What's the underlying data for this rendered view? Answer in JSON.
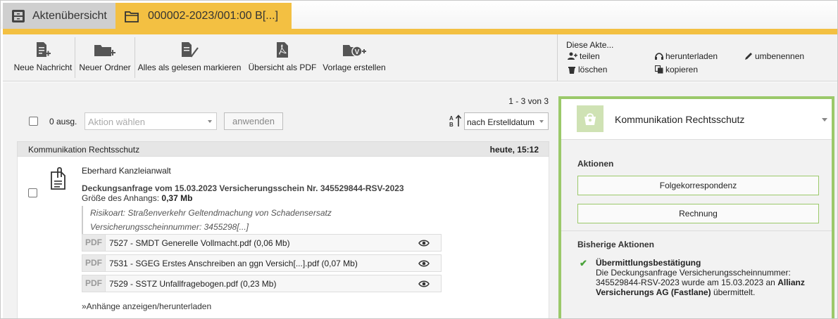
{
  "tabs": {
    "home_label": "Aktenübersicht",
    "active_label": "000002-2023/001:00 B[...]"
  },
  "toolbar": {
    "new_message": "Neue Nachricht",
    "new_folder": "Neuer Ordner",
    "mark_all_read": "Alles als gelesen markieren",
    "overview_pdf": "Übersicht als PDF",
    "create_template": "Vorlage erstellen"
  },
  "akte_menu": {
    "title": "Diese Akte...",
    "share": "teilen",
    "delete": "löschen",
    "download": "herunterladen",
    "copy": "kopieren",
    "rename": "umbenennen"
  },
  "list": {
    "count": "1 - 3 von 3",
    "selected": "0 ausg.",
    "action_placeholder": "Aktion wählen",
    "apply": "anwenden",
    "sort_value": "nach Erstelldatum"
  },
  "message": {
    "group": "Kommunikation Rechtsschutz",
    "time": "heute, 15:12",
    "sender": "Eberhard Kanzleianwalt",
    "subject": "Deckungsanfrage vom 15.03.2023 Versicherungsschein Nr. 345529844-RSV-2023",
    "attachment_size_label": "Größe des Anhangs:",
    "attachment_size": "0,37 Mb",
    "quote_line1": "Risikoart: Straßenverkehr Geltendmachung von Schadensersatz",
    "quote_line2": "Versicherungsscheinnummer: 3455298[...]",
    "attachments": [
      {
        "type": "PDF",
        "name": "7527 - SMDT Generelle Vollmacht.pdf (0,06 Mb)"
      },
      {
        "type": "PDF",
        "name": "7531 - SGEG Erstes Anschreiben an ggn Versich[...].pdf (0,07 Mb)"
      },
      {
        "type": "PDF",
        "name": "7529 - SSTZ Unfallfragebogen.pdf (0,23 Mb)"
      }
    ],
    "show_attachments": "»Anhänge anzeigen/herunterladen"
  },
  "panel": {
    "title": "Kommunikation Rechtsschutz",
    "actions_title": "Aktionen",
    "action1": "Folgekorrespondenz",
    "action2": "Rechnung",
    "history_title": "Bisherige Aktionen",
    "history_item_title": "Übermittlungsbestätigung",
    "history_text_1": "Die Deckungsanfrage Versicherungsscheinnummer: 345529844-RSV-2023 wurde am 15.03.2023 an ",
    "history_text_bold": "Allianz Versicherungs AG (Fastlane)",
    "history_text_2": " übermittelt."
  },
  "colors": {
    "accent_yellow": "#f3c042",
    "panel_green": "#9bc96a",
    "check_green": "#4aa33b"
  }
}
